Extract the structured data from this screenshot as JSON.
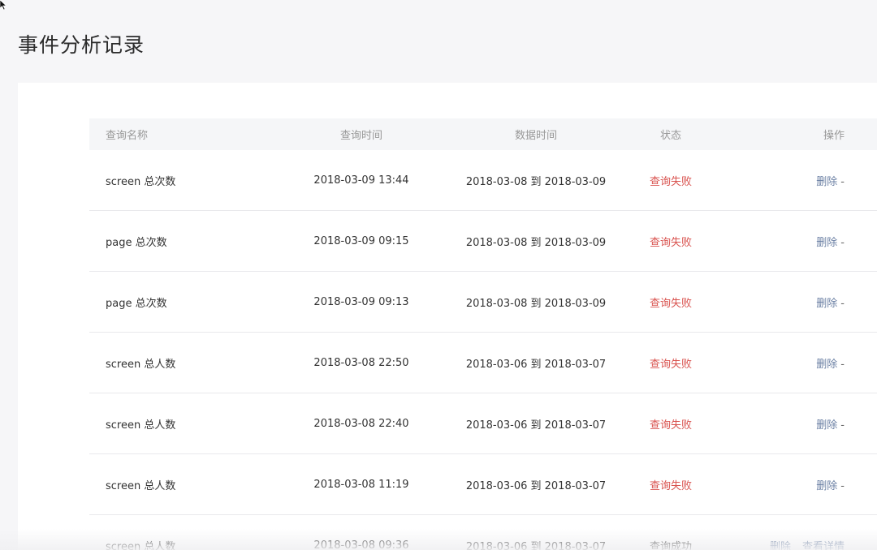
{
  "page": {
    "title": "事件分析记录"
  },
  "table": {
    "headers": {
      "name": "查询名称",
      "query_time": "查询时间",
      "data_time": "数据时间",
      "status": "状态",
      "ops": "操作"
    },
    "rows": [
      {
        "name": "screen 总次数",
        "query_time": "2018-03-09 13:44",
        "data_time": "2018-03-08 到 2018-03-09",
        "status": "查询失败",
        "delete": "删除",
        "dash": "-",
        "detail": ""
      },
      {
        "name": "page 总次数",
        "query_time": "2018-03-09 09:15",
        "data_time": "2018-03-08 到 2018-03-09",
        "status": "查询失败",
        "delete": "删除",
        "dash": "-",
        "detail": ""
      },
      {
        "name": "page 总次数",
        "query_time": "2018-03-09 09:13",
        "data_time": "2018-03-08 到 2018-03-09",
        "status": "查询失败",
        "delete": "删除",
        "dash": "-",
        "detail": ""
      },
      {
        "name": "screen 总人数",
        "query_time": "2018-03-08 22:50",
        "data_time": "2018-03-06 到 2018-03-07",
        "status": "查询失败",
        "delete": "删除",
        "dash": "-",
        "detail": ""
      },
      {
        "name": "screen 总人数",
        "query_time": "2018-03-08 22:40",
        "data_time": "2018-03-06 到 2018-03-07",
        "status": "查询失败",
        "delete": "删除",
        "dash": "-",
        "detail": ""
      },
      {
        "name": "screen 总人数",
        "query_time": "2018-03-08 11:19",
        "data_time": "2018-03-06 到 2018-03-07",
        "status": "查询失败",
        "delete": "删除",
        "dash": "-",
        "detail": ""
      },
      {
        "name": "screen 总人数",
        "query_time": "2018-03-08 09:36",
        "data_time": "2018-03-06 到 2018-03-07",
        "status": "查询成功",
        "delete": "删除",
        "dash": "",
        "detail": "查看详情"
      }
    ]
  },
  "colors": {
    "fail": "#d9534f",
    "link": "#6a7fa3",
    "header_bg": "#f5f6f8"
  },
  "icons": {
    "cursor": "mouse-pointer-icon"
  }
}
